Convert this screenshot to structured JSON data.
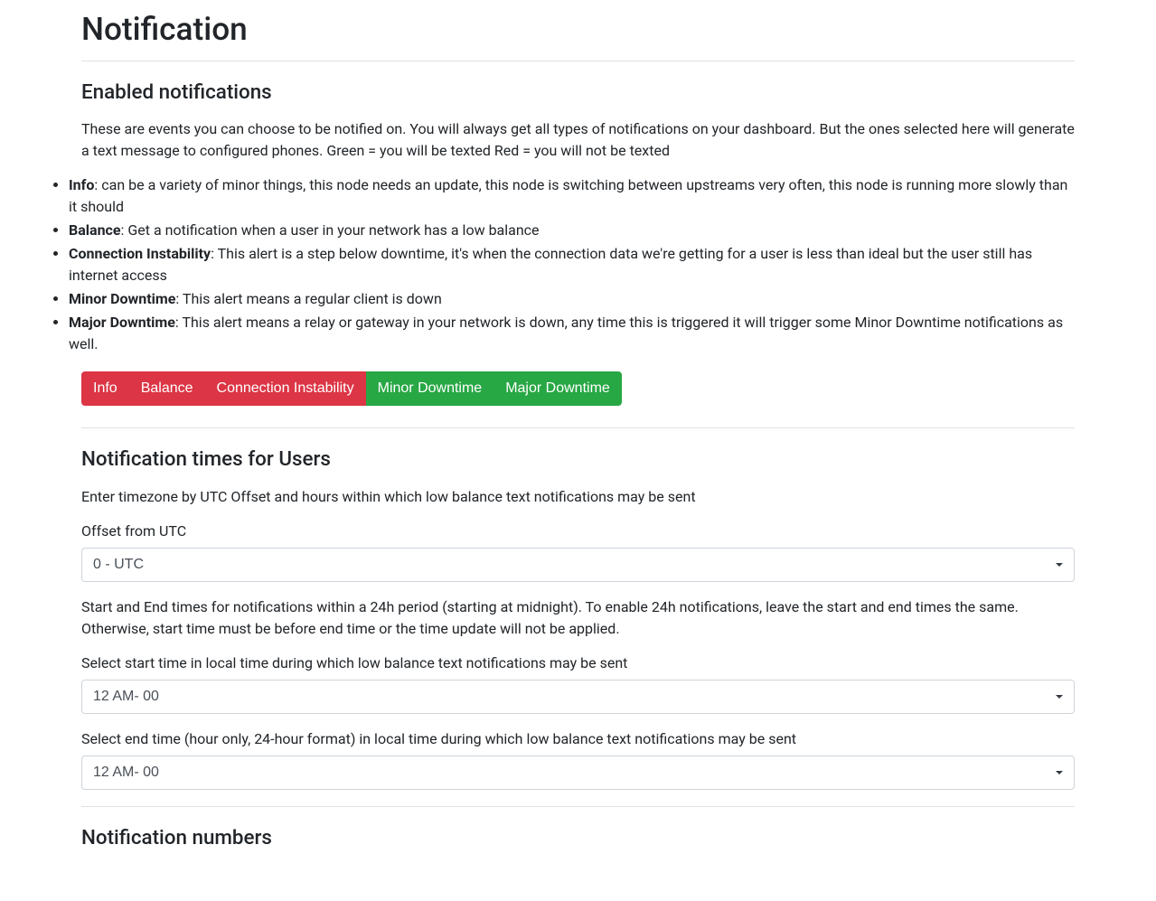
{
  "page": {
    "title": "Notification"
  },
  "enabled": {
    "heading": "Enabled notifications",
    "intro": "These are events you can choose to be notified on. You will always get all types of notifications on your dashboard. But the ones selected here will generate a text message to configured phones. Green = you will be texted Red = you will not be texted",
    "items": [
      {
        "label": "Info",
        "desc": ": can be a variety of minor things, this node needs an update, this node is switching between upstreams very often, this node is running more slowly than it should"
      },
      {
        "label": "Balance",
        "desc": ": Get a notification when a user in your network has a low balance"
      },
      {
        "label": "Connection Instability",
        "desc": ": This alert is a step below downtime, it's when the connection data we're getting for a user is less than ideal but the user still has internet access"
      },
      {
        "label": "Minor Downtime",
        "desc": ": This alert means a regular client is down"
      },
      {
        "label": "Major Downtime",
        "desc": ": This alert means a relay or gateway in your network is down, any time this is triggered it will trigger some Minor Downtime notifications as well."
      }
    ]
  },
  "toggles": [
    {
      "label": "Info",
      "enabled": false
    },
    {
      "label": "Balance",
      "enabled": false
    },
    {
      "label": "Connection Instability",
      "enabled": false
    },
    {
      "label": "Minor Downtime",
      "enabled": true
    },
    {
      "label": "Major Downtime",
      "enabled": true
    }
  ],
  "times": {
    "heading": "Notification times for Users",
    "intro": "Enter timezone by UTC Offset and hours within which low balance text notifications may be sent",
    "offset_label": "Offset from UTC",
    "offset_value": "0 - UTC",
    "range_note": "Start and End times for notifications within a 24h period (starting at midnight). To enable 24h notifications, leave the start and end times the same. Otherwise, start time must be before end time or the time update will not be applied.",
    "start_label": "Select start time in local time during which low balance text notifications may be sent",
    "start_value": "12 AM- 00",
    "end_label": "Select end time (hour only, 24-hour format) in local time during which low balance text notifications may be sent",
    "end_value": "12 AM- 00"
  },
  "numbers": {
    "heading": "Notification numbers"
  }
}
